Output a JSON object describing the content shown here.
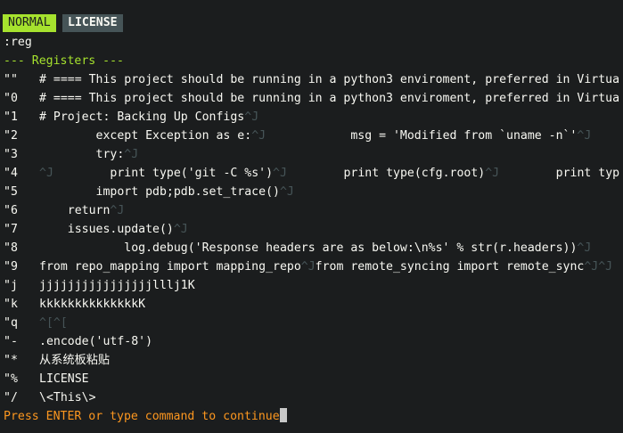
{
  "tabline": {
    "mode": "NORMAL",
    "file": "LICENSE"
  },
  "command": ":reg",
  "header": "--- Registers ---",
  "registers": [
    {
      "name": "\"\"",
      "content": [
        {
          "t": "# ==== This project should be running in a python3 enviroment, preferred in Virtua"
        }
      ]
    },
    {
      "name": "\"0",
      "content": [
        {
          "t": "# ==== This project should be running in a python3 enviroment, preferred in Virtua"
        }
      ]
    },
    {
      "name": "\"1",
      "content": [
        {
          "t": "# Project: Backing Up Configs"
        },
        {
          "c": "^J"
        }
      ]
    },
    {
      "name": "\"2",
      "content": [
        {
          "t": "        except Exception as e:"
        },
        {
          "c": "^J"
        },
        {
          "t": "            msg = 'Modified from `uname -n`'"
        },
        {
          "c": "^J"
        }
      ]
    },
    {
      "name": "\"3",
      "content": [
        {
          "t": "        try:"
        },
        {
          "c": "^J"
        }
      ]
    },
    {
      "name": "\"4",
      "content": [
        {
          "c": "^J"
        },
        {
          "t": "        print type('git -C %s')"
        },
        {
          "c": "^J"
        },
        {
          "t": "        print type(cfg.root)"
        },
        {
          "c": "^J"
        },
        {
          "t": "        print typ"
        }
      ]
    },
    {
      "name": "\"5",
      "content": [
        {
          "t": "        import pdb;pdb.set_trace()"
        },
        {
          "c": "^J"
        }
      ]
    },
    {
      "name": "\"6",
      "content": [
        {
          "t": "    return"
        },
        {
          "c": "^J"
        }
      ]
    },
    {
      "name": "\"7",
      "content": [
        {
          "t": "    issues.update()"
        },
        {
          "c": "^J"
        }
      ]
    },
    {
      "name": "\"8",
      "content": [
        {
          "t": "            log.debug('Response headers are as below:\\n%s' % str(r.headers))"
        },
        {
          "c": "^J"
        }
      ]
    },
    {
      "name": "\"9",
      "content": [
        {
          "t": "from repo_mapping import mapping_repo"
        },
        {
          "c": "^J"
        },
        {
          "t": "from remote_syncing import remote_sync"
        },
        {
          "c": "^J^J"
        }
      ]
    },
    {
      "name": "\"j",
      "content": [
        {
          "t": "jjjjjjjjjjjjjjjjlllj1K"
        }
      ]
    },
    {
      "name": "\"k",
      "content": [
        {
          "t": "kkkkkkkkkkkkkkK"
        }
      ]
    },
    {
      "name": "\"q",
      "content": [
        {
          "c": "^[^["
        }
      ]
    },
    {
      "name": "\"-",
      "content": [
        {
          "t": ".encode('utf-8')"
        }
      ]
    },
    {
      "name": "\"*",
      "content": [
        {
          "t": "从系统板粘贴"
        }
      ]
    },
    {
      "name": "\"%",
      "content": [
        {
          "t": "LICENSE"
        }
      ]
    },
    {
      "name": "\"/",
      "content": [
        {
          "t": "\\<This\\>"
        }
      ]
    }
  ],
  "prompt": "Press ENTER or type command to continue",
  "colors": {
    "background": "#1b1d1e",
    "mode_bg": "#a6e22e",
    "tab_bg": "#465457",
    "header": "#a6e22e",
    "prompt": "#fd971f",
    "control_chars": "#465457"
  }
}
